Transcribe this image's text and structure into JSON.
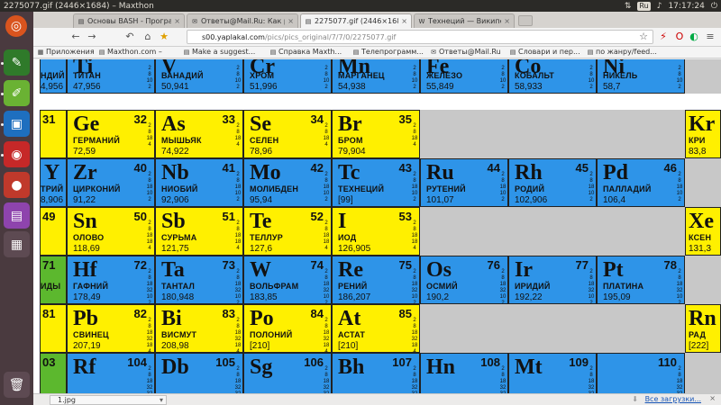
{
  "system": {
    "window_title": "2275077.gif (2446×1684) – Maxthon",
    "time": "17:17:24",
    "keyboard_layout": "Ru"
  },
  "launcher": {
    "items": [
      "ubuntu-dash-icon",
      "inkscape-icon",
      "editor-icon",
      "screen-icon",
      "record-icon",
      "video-icon",
      "workspace-icon",
      "trash-icon"
    ]
  },
  "tabs": [
    {
      "label": "Основы BASH - Программ",
      "icon": "page-icon",
      "active": false
    },
    {
      "label": "Ответы@Mail.Ru: Как расс",
      "icon": "mail-icon",
      "active": false
    },
    {
      "label": "2275077.gif (2446×1684)",
      "icon": "page-icon",
      "active": true
    },
    {
      "label": "Технеций — Википедия",
      "icon": "wiki-icon",
      "active": false
    }
  ],
  "nav": {
    "url_host": "s00.yaplakal.com",
    "url_path": "/pics/pics_original/7/7/0/2275077.gif"
  },
  "bookmarks": [
    {
      "label": "Приложения"
    },
    {
      "label": "Maxthon.com –"
    },
    {
      "label": "Make a suggest..."
    },
    {
      "label": "Справка Maxth..."
    },
    {
      "label": "Телепрограмм..."
    },
    {
      "label": "Ответы@Mail.Ru"
    },
    {
      "label": "Словари и пер..."
    },
    {
      "label": "по жанру/feed..."
    }
  ],
  "elements": {
    "row1": [
      {
        "sym": "Ti",
        "num": "",
        "name": "ТИТАН",
        "mass": "47,956",
        "color": "blue"
      },
      {
        "sym": "V",
        "num": "",
        "name": "ВАНАДИЙ",
        "mass": "50,941",
        "color": "blue"
      },
      {
        "sym": "Cr",
        "num": "",
        "name": "ХРОМ",
        "mass": "51,996",
        "color": "blue"
      },
      {
        "sym": "Mn",
        "num": "",
        "name": "МАРГАНЕЦ",
        "mass": "54,938",
        "color": "blue"
      },
      {
        "sym": "Fe",
        "num": "",
        "name": "ЖЕЛЕЗО",
        "mass": "55,849",
        "color": "blue"
      },
      {
        "sym": "Co",
        "num": "",
        "name": "КОБАЛЬТ",
        "mass": "58,933",
        "color": "blue"
      },
      {
        "sym": "Ni",
        "num": "",
        "name": "НИКЕЛЬ",
        "mass": "58,7",
        "color": "blue"
      }
    ],
    "row1_left": {
      "name": "НДИЙ",
      "mass": "4,956"
    },
    "row2": [
      {
        "sym": "Ge",
        "num": "32",
        "name": "ГЕРМАНИЙ",
        "mass": "72,59",
        "color": "yellow"
      },
      {
        "sym": "As",
        "num": "33",
        "name": "МЫШЬЯК",
        "mass": "74,922",
        "color": "yellow"
      },
      {
        "sym": "Se",
        "num": "34",
        "name": "СЕЛЕН",
        "mass": "78,96",
        "color": "yellow"
      },
      {
        "sym": "Br",
        "num": "35",
        "name": "БРОМ",
        "mass": "79,904",
        "color": "yellow"
      }
    ],
    "row2_left": {
      "num": "31"
    },
    "row2_right": {
      "sym": "Kr",
      "name": "КРИ",
      "mass": "83,8"
    },
    "row3": [
      {
        "sym": "Zr",
        "num": "40",
        "name": "ЦИРКОНИЙ",
        "mass": "91,22",
        "color": "blue"
      },
      {
        "sym": "Nb",
        "num": "41",
        "name": "НИОБИЙ",
        "mass": "92,906",
        "color": "blue"
      },
      {
        "sym": "Mo",
        "num": "42",
        "name": "МОЛИБДЕН",
        "mass": "95,94",
        "color": "blue"
      },
      {
        "sym": "Tc",
        "num": "43",
        "name": "ТЕХНЕЦИЙ",
        "mass": "[99]",
        "color": "blue"
      },
      {
        "sym": "Ru",
        "num": "44",
        "name": "РУТЕНИЙ",
        "mass": "101,07",
        "color": "blue"
      },
      {
        "sym": "Rh",
        "num": "45",
        "name": "РОДИЙ",
        "mass": "102,906",
        "color": "blue"
      },
      {
        "sym": "Pd",
        "num": "46",
        "name": "ПАЛЛАДИЙ",
        "mass": "106,4",
        "color": "blue"
      }
    ],
    "row3_left": {
      "sym": "Y",
      "name": "ТРИЙ",
      "mass": "8,906"
    },
    "row4": [
      {
        "sym": "Sn",
        "num": "50",
        "name": "ОЛОВО",
        "mass": "118,69",
        "color": "yellow"
      },
      {
        "sym": "Sb",
        "num": "51",
        "name": "СУРЬМА",
        "mass": "121,75",
        "color": "yellow"
      },
      {
        "sym": "Te",
        "num": "52",
        "name": "ТЕЛЛУР",
        "mass": "127,6",
        "color": "yellow"
      },
      {
        "sym": "I",
        "num": "53",
        "name": "ИОД",
        "mass": "126,905",
        "color": "yellow"
      }
    ],
    "row4_left": {
      "num": "49"
    },
    "row4_right": {
      "sym": "Xe",
      "name": "КСЕН",
      "mass": "131,3"
    },
    "row5": [
      {
        "sym": "Hf",
        "num": "72",
        "name": "ГАФНИЙ",
        "mass": "178,49",
        "color": "blue"
      },
      {
        "sym": "Ta",
        "num": "73",
        "name": "ТАНТАЛ",
        "mass": "180,948",
        "color": "blue"
      },
      {
        "sym": "W",
        "num": "74",
        "name": "ВОЛЬФРАМ",
        "mass": "183,85",
        "color": "blue"
      },
      {
        "sym": "Re",
        "num": "75",
        "name": "РЕНИЙ",
        "mass": "186,207",
        "color": "blue"
      },
      {
        "sym": "Os",
        "num": "76",
        "name": "ОСМИЙ",
        "mass": "190,2",
        "color": "blue"
      },
      {
        "sym": "Ir",
        "num": "77",
        "name": "ИРИДИЙ",
        "mass": "192,22",
        "color": "blue"
      },
      {
        "sym": "Pt",
        "num": "78",
        "name": "ПЛАТИНА",
        "mass": "195,09",
        "color": "blue"
      }
    ],
    "row5_left": {
      "num": "71",
      "name": "ИДЫ"
    },
    "row6": [
      {
        "sym": "Pb",
        "num": "82",
        "name": "СВИНЕЦ",
        "mass": "207,19",
        "color": "yellow"
      },
      {
        "sym": "Bi",
        "num": "83",
        "name": "ВИСМУТ",
        "mass": "208,98",
        "color": "yellow"
      },
      {
        "sym": "Po",
        "num": "84",
        "name": "ПОЛОНИЙ",
        "mass": "[210]",
        "color": "yellow"
      },
      {
        "sym": "At",
        "num": "85",
        "name": "АСТАТ",
        "mass": "[210]",
        "color": "yellow"
      }
    ],
    "row6_left": {
      "num": "81"
    },
    "row6_right": {
      "sym": "Rn",
      "name": "РАД",
      "mass": "[222]"
    },
    "row7": [
      {
        "sym": "Rf",
        "num": "104",
        "color": "blue"
      },
      {
        "sym": "Db",
        "num": "105",
        "color": "blue"
      },
      {
        "sym": "Sg",
        "num": "106",
        "color": "blue"
      },
      {
        "sym": "Bh",
        "num": "107",
        "color": "blue"
      },
      {
        "sym": "Hn",
        "num": "108",
        "color": "blue"
      },
      {
        "sym": "Mt",
        "num": "109",
        "color": "blue"
      },
      {
        "sym": "",
        "num": "110",
        "color": "blue"
      }
    ],
    "row7_left": {
      "num": "03"
    }
  },
  "downloads": {
    "file": "1.jpg",
    "all_label": "Все загрузки..."
  },
  "colors": {
    "blue": "#2e94e8",
    "yellow": "#fff000",
    "green": "#5cb82e",
    "gray": "#c8c8c8"
  }
}
